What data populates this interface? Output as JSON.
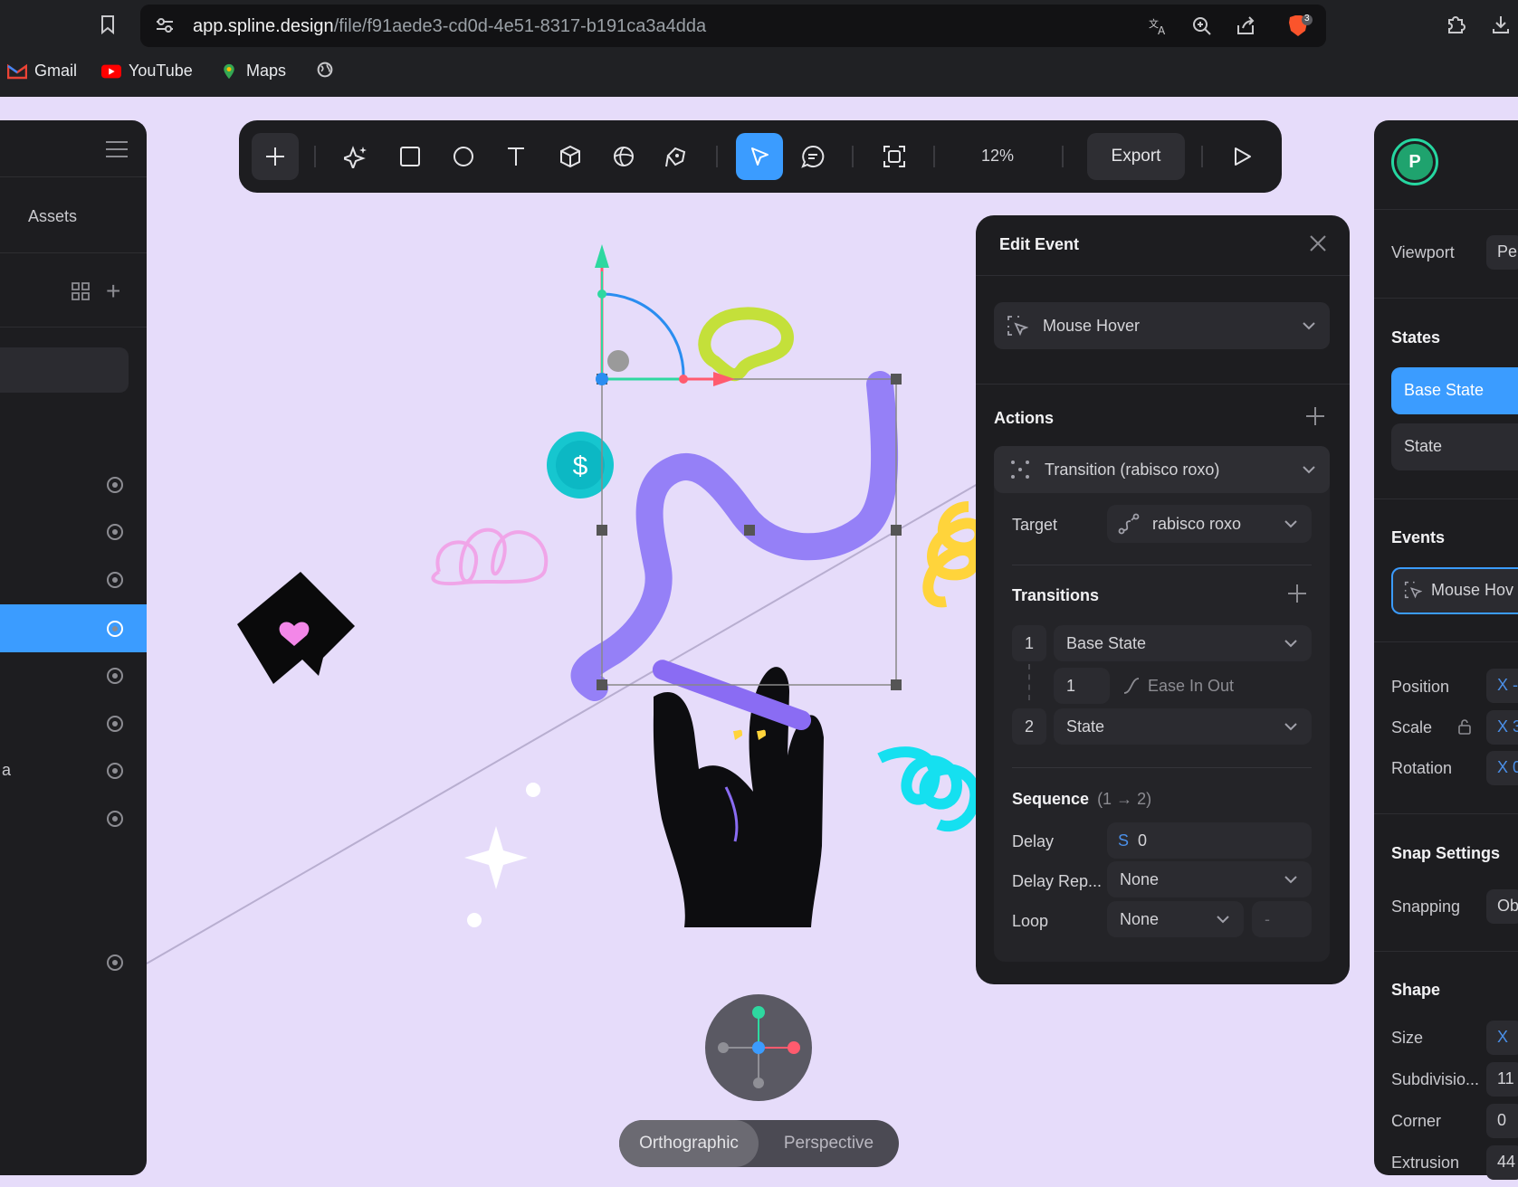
{
  "browser": {
    "url_domain": "app.spline.design",
    "url_path": "/file/f91aede3-cd0d-4e51-8317-b191ca3a4dda",
    "brave_badge": "3",
    "bookmarks": [
      "Gmail",
      "YouTube",
      "Maps"
    ]
  },
  "left_panel": {
    "assets_tab": "Assets",
    "partial_item_text": "a"
  },
  "toolbar": {
    "zoom": "12%",
    "export_label": "Export"
  },
  "edit_event": {
    "title": "Edit Event",
    "event_type": "Mouse Hover",
    "actions_heading": "Actions",
    "action": "Transition (rabisco roxo)",
    "target_label": "Target",
    "target_value": "rabisco roxo",
    "transitions_heading": "Transitions",
    "transitions": [
      {
        "index": "1",
        "state": "Base State"
      },
      {
        "index": "2",
        "state": "State"
      }
    ],
    "duration": "1",
    "easing": "Ease In Out",
    "sequence_heading": "Sequence",
    "sequence_range": "(1 → 2)",
    "delay_label": "Delay",
    "delay_unit": "S",
    "delay_value": "0",
    "delay_repeat_label": "Delay Rep...",
    "delay_repeat_value": "None",
    "loop_label": "Loop",
    "loop_value": "None",
    "loop_extra": "-"
  },
  "right_panel": {
    "avatar_letter": "P",
    "viewport_label": "Viewport",
    "viewport_value": "Pe",
    "states_heading": "States",
    "states": [
      "Base State",
      "State"
    ],
    "events_heading": "Events",
    "event_item": "Mouse Hov",
    "position_label": "Position",
    "position_value": "X -",
    "scale_label": "Scale",
    "scale_value": "X 3",
    "rotation_label": "Rotation",
    "rotation_value": "X 0",
    "snap_heading": "Snap Settings",
    "snapping_label": "Snapping",
    "snapping_value": "Ob",
    "shape_heading": "Shape",
    "size_label": "Size",
    "size_value": "X",
    "subdivision_label": "Subdivisio...",
    "subdivision_value": "11",
    "corner_label": "Corner",
    "corner_value": "0",
    "extrusion_label": "Extrusion",
    "extrusion_value": "44"
  },
  "canvas": {
    "coin_symbol": "$"
  },
  "view_toggle": {
    "active": "Orthographic",
    "other": "Perspective"
  },
  "colors": {
    "accent_blue": "#3b9cff",
    "canvas_bg": "#e6dcfa",
    "panel_bg": "#1d1d20",
    "purple_scribble": "#9580f7",
    "lime": "#c4e03a",
    "yellow": "#ffd43b",
    "cyan": "#15e0f0"
  }
}
